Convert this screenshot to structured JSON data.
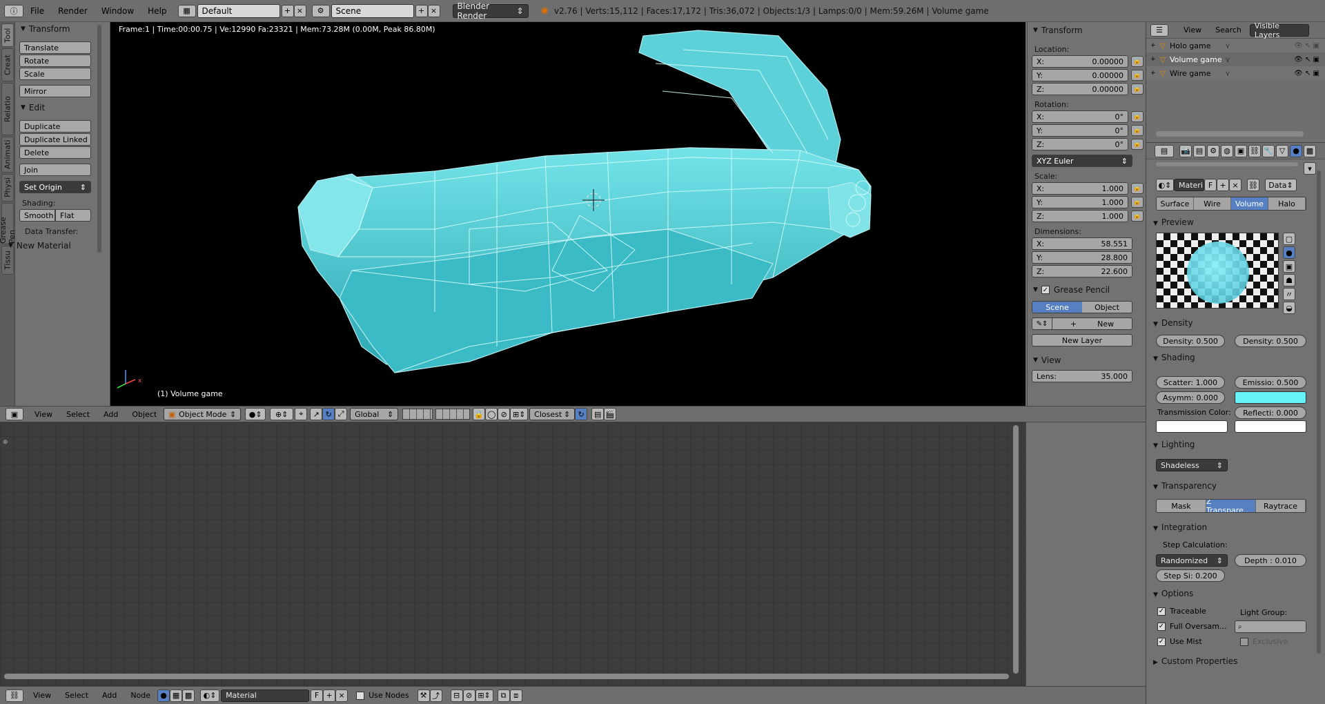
{
  "topbar": {
    "menus": [
      "File",
      "Render",
      "Window",
      "Help"
    ],
    "layout": "Default",
    "scene": "Scene",
    "engine": "Blender Render",
    "stats": "v2.76 | Verts:15,112 | Faces:17,172 | Tris:36,072 | Objects:1/3 | Lamps:0/0 | Mem:59.26M | Volume game"
  },
  "vtabs": [
    "Tool",
    "Creat",
    "Relatio",
    "Animati",
    "Physi",
    "Grease Pen",
    "Tissu"
  ],
  "toolshelf": {
    "transform_title": "Transform",
    "transform_btns": [
      "Translate",
      "Rotate",
      "Scale"
    ],
    "mirror": "Mirror",
    "edit_title": "Edit",
    "edit_btns": [
      "Duplicate",
      "Duplicate Linked",
      "Delete"
    ],
    "join": "Join",
    "set_origin": "Set Origin",
    "shading_label": "Shading:",
    "smooth": "Smooth",
    "flat": "Flat",
    "data_transfer": "Data Transfer:",
    "new_material": "New Material"
  },
  "viewport": {
    "info": "Frame:1 | Time:00:00.75 | Ve:12990 Fa:23321 | Mem:73.28M (0.00M, Peak 86.80M)",
    "object_label": "(1) Volume game",
    "mesh_color": "#5ee6f0"
  },
  "npanel": {
    "transform_title": "Transform",
    "location_label": "Location:",
    "location": [
      {
        "axis": "X:",
        "value": "0.00000"
      },
      {
        "axis": "Y:",
        "value": "0.00000"
      },
      {
        "axis": "Z:",
        "value": "0.00000"
      }
    ],
    "rotation_label": "Rotation:",
    "rotation": [
      {
        "axis": "X:",
        "value": "0°"
      },
      {
        "axis": "Y:",
        "value": "0°"
      },
      {
        "axis": "Z:",
        "value": "0°"
      }
    ],
    "rotation_mode": "XYZ Euler",
    "scale_label": "Scale:",
    "scale": [
      {
        "axis": "X:",
        "value": "1.000"
      },
      {
        "axis": "Y:",
        "value": "1.000"
      },
      {
        "axis": "Z:",
        "value": "1.000"
      }
    ],
    "dimensions_label": "Dimensions:",
    "dimensions": [
      {
        "axis": "X:",
        "value": "58.551"
      },
      {
        "axis": "Y:",
        "value": "28.800"
      },
      {
        "axis": "Z:",
        "value": "22.600"
      }
    ],
    "grease_pencil_title": "Grease Pencil",
    "gp_scene": "Scene",
    "gp_object": "Object",
    "gp_new": "New",
    "gp_new_layer": "New Layer",
    "view_title": "View",
    "lens_label": "Lens:",
    "lens_value": "35.000"
  },
  "view3d_header": {
    "menus": [
      "View",
      "Select",
      "Add",
      "Object"
    ],
    "mode": "Object Mode",
    "orientation": "Global",
    "snap": "Closest"
  },
  "node_header": {
    "menus": [
      "View",
      "Select",
      "Add",
      "Node"
    ],
    "material": "Material",
    "fake_user": "F",
    "use_nodes": "Use Nodes"
  },
  "outliner": {
    "menus": [
      "View",
      "Search"
    ],
    "filter": "Visible Layers",
    "items": [
      "Holo game",
      "Volume game",
      "Wire game"
    ]
  },
  "props": {
    "material_name": "Materi",
    "fake_user": "F",
    "link": "Data",
    "type_tabs": [
      "Surface",
      "Wire",
      "Volume",
      "Halo"
    ],
    "active_type": "Volume",
    "preview_title": "Preview",
    "density_title": "Density",
    "density_left": "Density: 0.500",
    "density_right": "Density: 0.500",
    "shading_title": "Shading",
    "scatter": "Scatter: 1.000",
    "emission": "Emissio: 0.500",
    "asymm": "Asymm: 0.000",
    "emission_color": "#66f2f8",
    "transmission_label": "Transmission Color:",
    "reflection": "Reflecti: 0.000",
    "lighting_title": "Lighting",
    "lighting_mode": "Shadeless",
    "transparency_title": "Transparency",
    "transparency_tabs": [
      "Mask",
      "Z Transpare...",
      "Raytrace"
    ],
    "integration_title": "Integration",
    "step_calc_label": "Step Calculation:",
    "step_method": "Randomized",
    "depth": "Depth : 0.010",
    "step_size": "Step Si: 0.200",
    "options_title": "Options",
    "traceable": "Traceable",
    "light_group_label": "Light Group:",
    "full_oversampling": "Full Oversam...",
    "use_mist": "Use Mist",
    "exclusive": "Exclusive",
    "custom_props_title": "Custom Properties"
  }
}
